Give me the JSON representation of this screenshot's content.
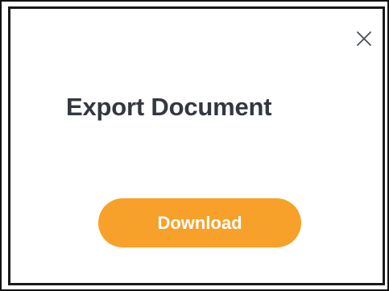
{
  "dialog": {
    "title": "Export Document",
    "close_icon": "close-icon",
    "download_label": "Download",
    "accent_color": "#f7a12a",
    "title_color": "#333840"
  }
}
